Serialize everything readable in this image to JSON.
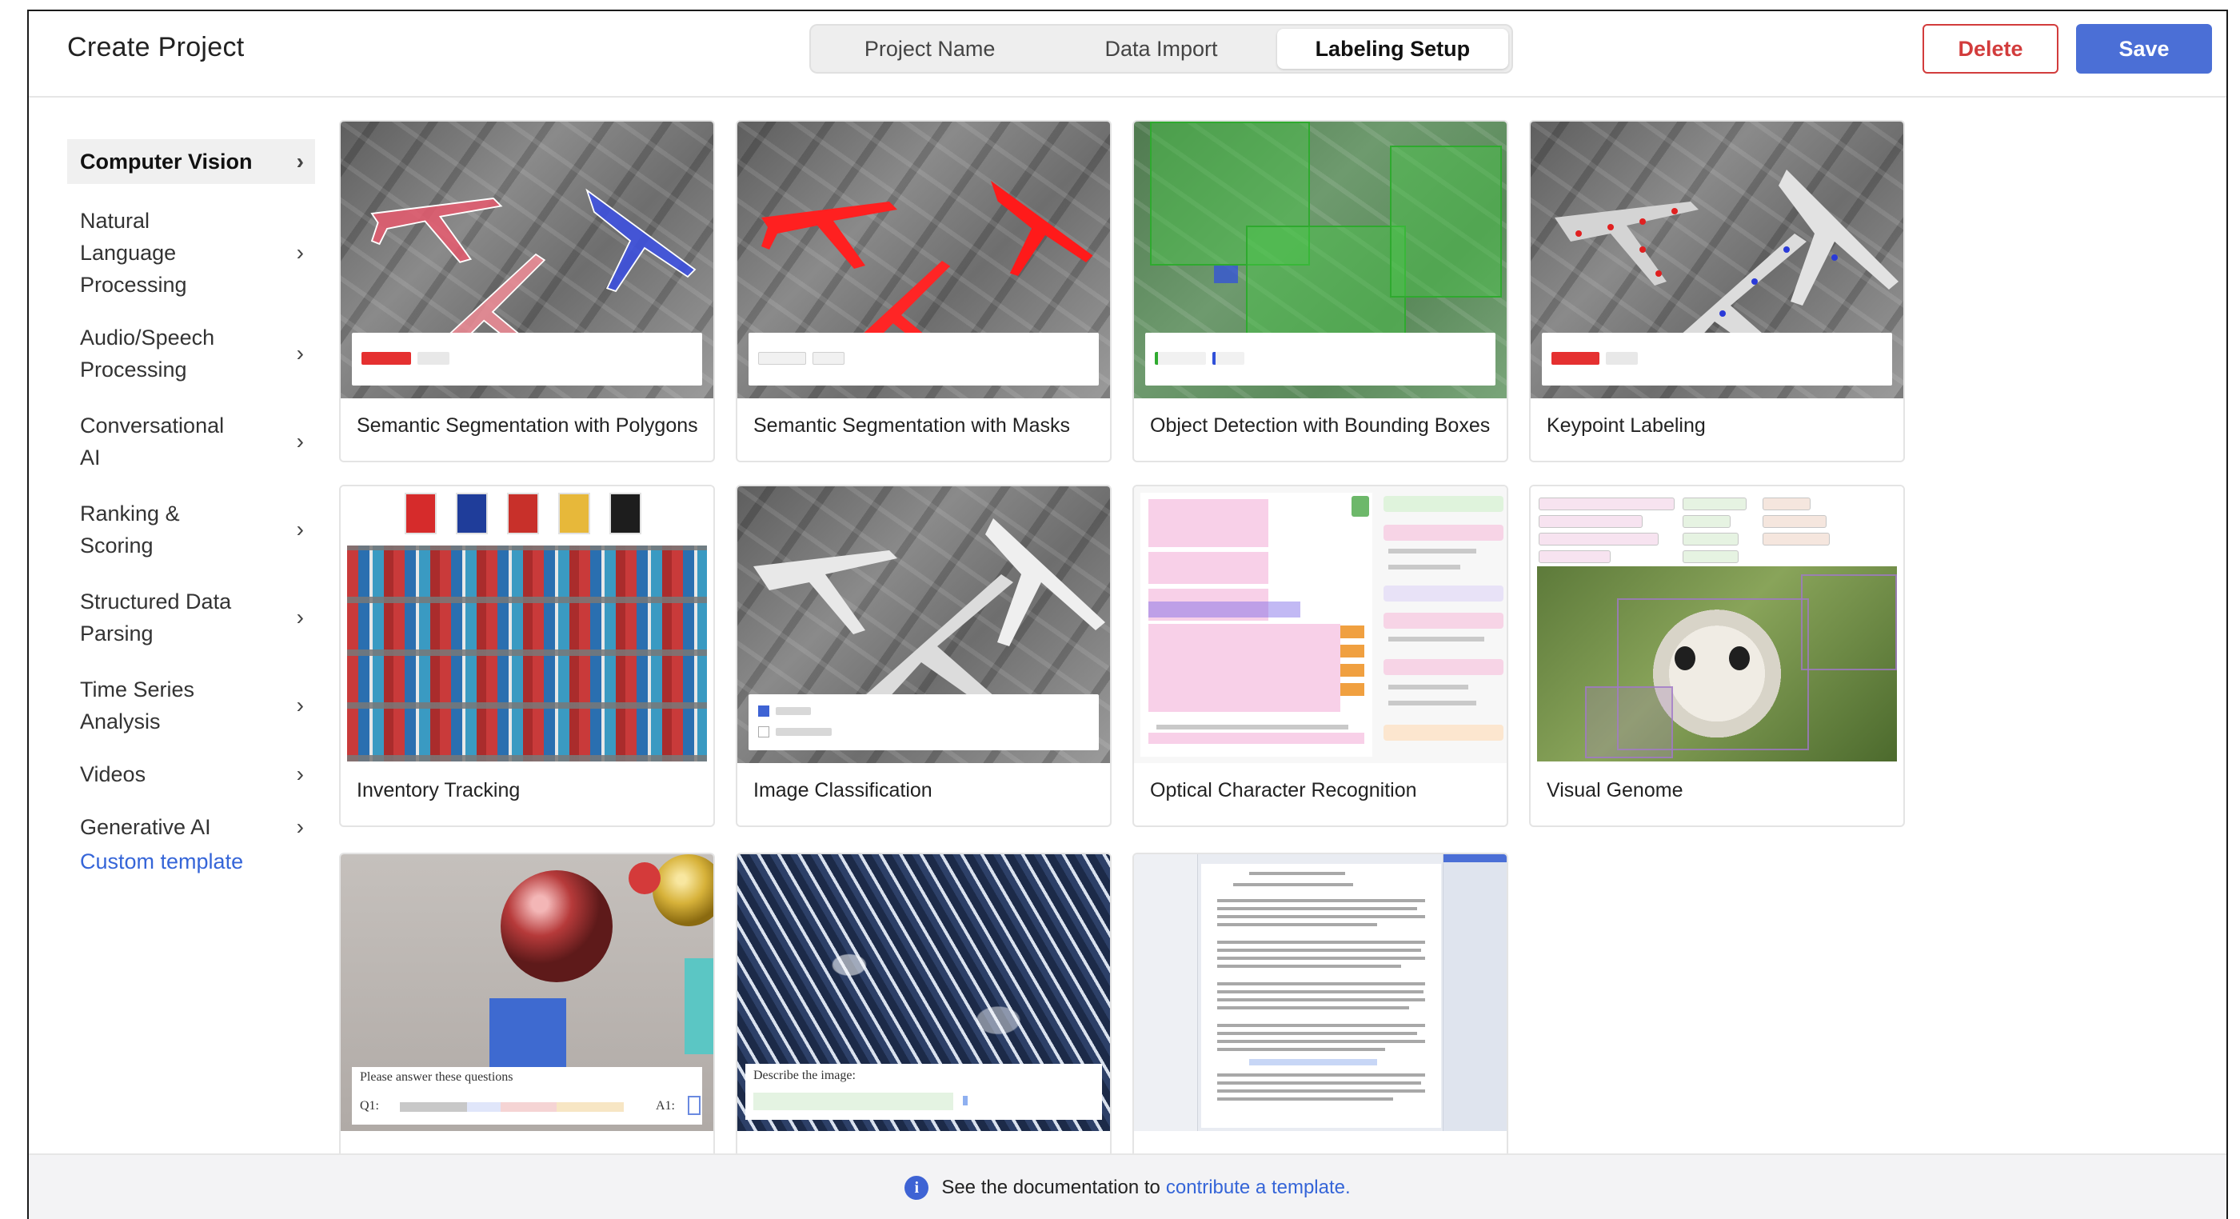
{
  "header": {
    "title": "Create Project",
    "steps": [
      "Project Name",
      "Data Import",
      "Labeling Setup"
    ],
    "active_step": "Labeling Setup",
    "delete_label": "Delete",
    "save_label": "Save",
    "colors": {
      "delete": "#d23c3c",
      "save": "#4b6fd6",
      "link": "#3565d8"
    }
  },
  "sidebar": {
    "categories": [
      {
        "label": "Computer Vision",
        "active": true
      },
      {
        "label": "Natural Language Processing",
        "active": false
      },
      {
        "label": "Audio/Speech Processing",
        "active": false
      },
      {
        "label": "Conversational AI",
        "active": false
      },
      {
        "label": "Ranking & Scoring",
        "active": false
      },
      {
        "label": "Structured Data Parsing",
        "active": false
      },
      {
        "label": "Time Series Analysis",
        "active": false
      },
      {
        "label": "Videos",
        "active": false
      },
      {
        "label": "Generative AI",
        "active": false
      }
    ],
    "chevron_icon": "chevron-right-icon",
    "custom_template": "Custom template"
  },
  "templates": [
    {
      "label": "Semantic Segmentation with Polygons",
      "thumb": "airport-polygons"
    },
    {
      "label": "Semantic Segmentation with Masks",
      "thumb": "airport-masks"
    },
    {
      "label": "Object Detection with Bounding Boxes",
      "thumb": "airport-boxes"
    },
    {
      "label": "Keypoint Labeling",
      "thumb": "airport-keypoints"
    },
    {
      "label": "Inventory Tracking",
      "thumb": "shelf"
    },
    {
      "label": "Image Classification",
      "thumb": "airport-classification"
    },
    {
      "label": "Optical Character Recognition",
      "thumb": "ocr"
    },
    {
      "label": "Visual Genome",
      "thumb": "panda"
    },
    {
      "label": "",
      "thumb": "spheres"
    },
    {
      "label": "",
      "thumb": "snow"
    },
    {
      "label": "",
      "thumb": "text-doc"
    }
  ],
  "thumb_text": {
    "spheres_question": "Please answer these questions",
    "spheres_q1": "Q1:",
    "spheres_a1": "A1:",
    "snow_prompt": "Describe the image:"
  },
  "footer": {
    "info_icon": "info-icon",
    "text": "See the documentation to",
    "link": "contribute a template."
  }
}
